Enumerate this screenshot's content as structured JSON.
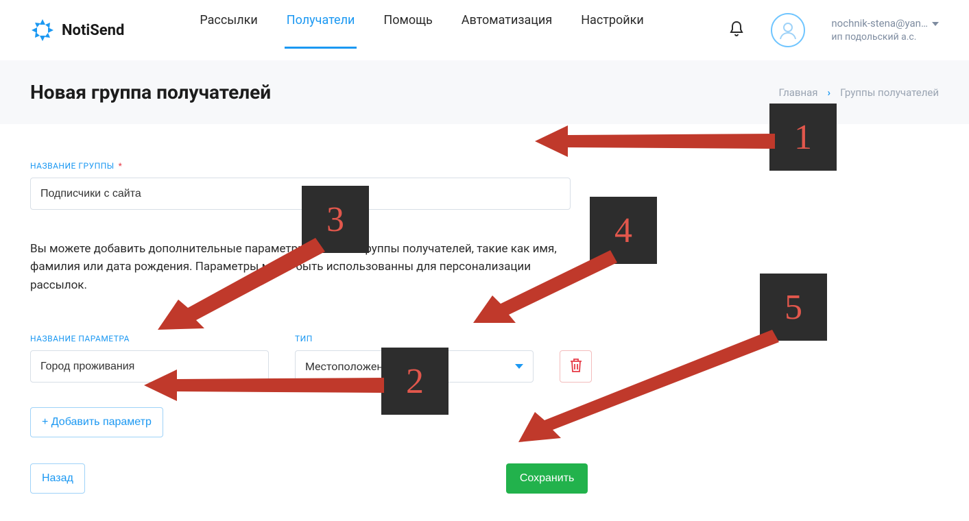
{
  "header": {
    "logo_text": "NotiSend",
    "nav": {
      "mailings": "Рассылки",
      "recipients": "Получатели",
      "help": "Помощь",
      "automation": "Автоматизация",
      "settings": "Настройки"
    },
    "account": {
      "email": "nochnik-stena@yan…",
      "sub": "ип подольский а.с."
    }
  },
  "titlebar": {
    "page_title": "Новая группа получателей",
    "crumbs": {
      "home": "Главная",
      "current": "Группы получателей"
    }
  },
  "form": {
    "group_name_label": "НАЗВАНИЕ ГРУППЫ",
    "group_name_value": "Подписчики с сайта",
    "helptext": "Вы можете добавить дополнительные параметры для этой группы получателей, такие как имя, фамилия или дата рождения. Параметры могут быть использованны для персонализации рассылок.",
    "param_name_label": "НАЗВАНИЕ ПАРАМЕТРА",
    "param_name_value": "Город проживания",
    "param_type_label": "ТИП",
    "param_type_value": "Местоположение",
    "add_param_label": "+ Добавить параметр",
    "back_label": "Назад",
    "save_label": "Сохранить"
  },
  "markers": {
    "m1": "1",
    "m2": "2",
    "m3": "3",
    "m4": "4",
    "m5": "5"
  }
}
